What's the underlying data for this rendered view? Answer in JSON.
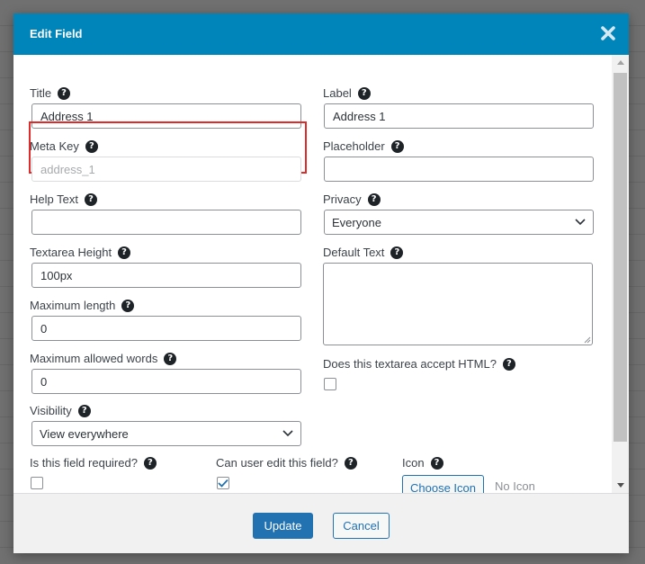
{
  "modal": {
    "title": "Edit Field",
    "close_icon": "close-x-icon"
  },
  "fields": {
    "title": {
      "label": "Title",
      "value": "Address 1"
    },
    "label": {
      "label": "Label",
      "value": "Address 1"
    },
    "meta_key": {
      "label": "Meta Key",
      "placeholder": "address_1"
    },
    "placeholder": {
      "label": "Placeholder",
      "value": ""
    },
    "help_text": {
      "label": "Help Text",
      "value": ""
    },
    "privacy": {
      "label": "Privacy",
      "selected": "Everyone"
    },
    "textarea_height": {
      "label": "Textarea Height",
      "value": "100px"
    },
    "default_text": {
      "label": "Default Text",
      "value": ""
    },
    "maximum_length": {
      "label": "Maximum length",
      "value": "0"
    },
    "maximum_words": {
      "label": "Maximum allowed words",
      "value": "0"
    },
    "accept_html": {
      "label": "Does this textarea accept HTML?",
      "checked": false
    },
    "visibility": {
      "label": "Visibility",
      "selected": "View everywhere"
    },
    "required": {
      "label": "Is this field required?",
      "checked": false
    },
    "editable": {
      "label": "Can user edit this field?",
      "checked": true
    },
    "icon": {
      "label": "Icon",
      "button": "Choose Icon",
      "status": "No Icon"
    }
  },
  "help_icon_glyph": "?",
  "footer": {
    "update_label": "Update",
    "cancel_label": "Cancel"
  },
  "colors": {
    "header": "#0085ba",
    "primary_button": "#2271b1",
    "highlight": "#e12a2a"
  }
}
